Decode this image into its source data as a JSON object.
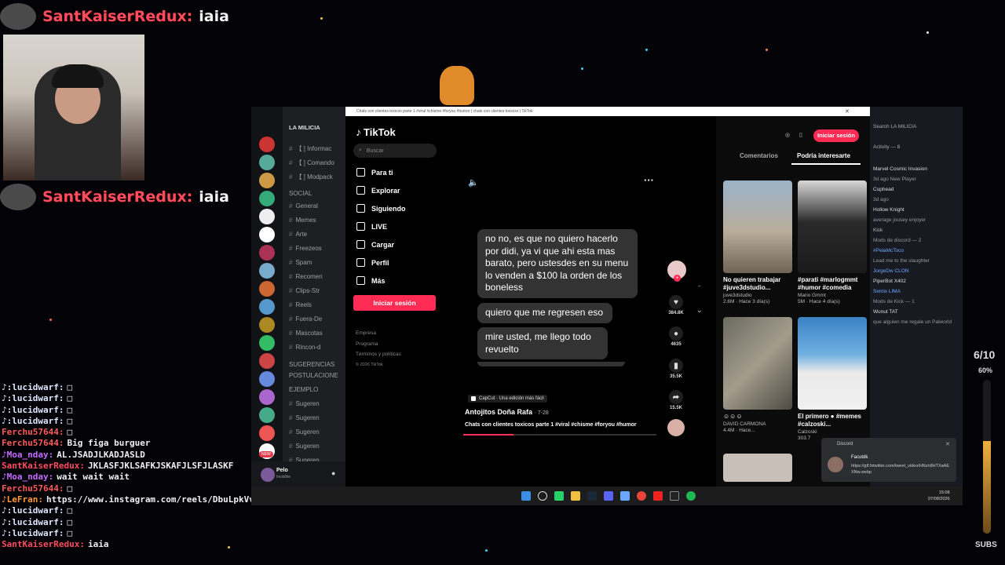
{
  "overlay": {
    "top_user": "SantKaiserRedux:",
    "top_message": "iaia",
    "mid_user": "SantKaiserRedux:",
    "mid_message": "iaia",
    "counter": "6/10",
    "percent": "60%",
    "subs_label": "SUBS"
  },
  "chat": [
    {
      "user": "♪:lucidwarf:",
      "msg": "□",
      "color": "#dfe7ff"
    },
    {
      "user": "♪:lucidwarf:",
      "msg": "□",
      "color": "#dfe7ff"
    },
    {
      "user": "♪:lucidwarf:",
      "msg": "□",
      "color": "#dfe7ff"
    },
    {
      "user": "♪:lucidwarf:",
      "msg": "□",
      "color": "#dfe7ff"
    },
    {
      "user": "Ferchu57644:",
      "msg": "□",
      "color": "#ff5a5a"
    },
    {
      "user": "Ferchu57644:",
      "msg": "Big figa burguer",
      "color": "#ff5a5a"
    },
    {
      "user": "♪Moa_nday:",
      "msg": "AL.JSADJLKADJASLD",
      "color": "#c56bff"
    },
    {
      "user": "SantKaiserRedux:",
      "msg": "JKLASFJKLSAFKJSKAFJLSFJLASKF",
      "color": "#ff4c5e"
    },
    {
      "user": "♪Moa_nday:",
      "msg": "wait wait wait",
      "color": "#c56bff"
    },
    {
      "user": "Ferchu57644:",
      "msg": "□",
      "color": "#ff5a5a"
    },
    {
      "user": "♪LeFran:",
      "msg": "https://www.instagram.com/reels/DbuLpkVvauS/",
      "color": "#ff9a3c"
    },
    {
      "user": "♪:lucidwarf:",
      "msg": "□",
      "color": "#dfe7ff"
    },
    {
      "user": "♪:lucidwarf:",
      "msg": "□",
      "color": "#dfe7ff"
    },
    {
      "user": "♪:lucidwarf:",
      "msg": "□",
      "color": "#dfe7ff"
    },
    {
      "user": "SantKaiserRedux:",
      "msg": "iaia",
      "color": "#ff4c5e"
    }
  ],
  "discord": {
    "server_name": "LA MILICIA",
    "channels": [
      "【 ] Informac",
      "【 ] Comando",
      "【 ] Modpack",
      "SOCIAL",
      "General",
      "Memes",
      "Arte",
      "Freezeos",
      "Spam",
      "Recomen",
      "Clips-Str",
      "Reels",
      "Fuera-De",
      "Mascotas",
      "Rincon-d",
      "SUGERENCIAS",
      "POSTULACIONE",
      "EJEMPLO",
      "Sugeren",
      "Sugeren",
      "Sugeren",
      "Sugeren",
      "Sugeren"
    ],
    "user_name": "Pelo",
    "user_status": "Invisible",
    "new_badge": "NEW"
  },
  "browser": {
    "tab_title": "Chats con clientes toxicos parte 1 #viral #chisme #foryou #humor | chats con clientes toxxxxx | TikTok"
  },
  "tiktok": {
    "logo": "TikTok",
    "search_placeholder": "Buscar",
    "nav": [
      "Para ti",
      "Explorar",
      "Siguiendo",
      "LIVE",
      "Cargar",
      "Perfil",
      "Más"
    ],
    "login_button": "Iniciar sesión",
    "footer": [
      "Empresa",
      "Programa",
      "Términos y políticas",
      "© 2026 TikTok"
    ],
    "header_login": "Iniciar sesión",
    "tabs": [
      "Comentarios",
      "Podría interesarte"
    ],
    "bubbles": [
      "no no, es que no quiero hacerlo por didi, ya vi que ahi esta mas barato, pero ustesdes en su menu lo venden a $100 la orden de los boneless",
      "quiero que me regresen eso",
      "mire usted, me llego todo revuelto"
    ],
    "capcut": "CapCut · Una edición más fácil",
    "author": "Antojitos Doña Rafa",
    "date": "· 7-28",
    "caption": "Chats con clientes toxicos parte 1 #viral #chisme #foryou #humor",
    "likes": "384.8K",
    "comments": "4635",
    "saves": "35.5K",
    "shares": "15.5K",
    "recommended": [
      {
        "title": "No quieren trabajar #juve3dstudio...",
        "author": "juve3dstudio",
        "stats": "2.6M · Hace 3 día(s)"
      },
      {
        "title": "#parati #marlogmmt #humor #comedia",
        "author": "Mario Gmmt",
        "stats": "5M · Hace 4 día(s)"
      },
      {
        "title": "☺☺☺",
        "author": "DAVID CARMONA",
        "stats": "4.4M · Hace..."
      },
      {
        "title": "El primero ● #memes #calzoski...",
        "author": "Calzoski",
        "stats": "303.7"
      }
    ]
  },
  "right_discord": {
    "search": "Search LA MILICIA",
    "activity": "Activity — 8",
    "items": [
      {
        "t": "Marvel Cosmic Invasion",
        "c": "#ddd"
      },
      {
        "t": "3d ago  New Player",
        "c": "#999"
      },
      {
        "t": "Cuphead",
        "c": "#ddd"
      },
      {
        "t": "3d ago",
        "c": "#999"
      },
      {
        "t": "Hollow Knight",
        "c": "#ddd"
      },
      {
        "t": "average jousey enjoyer",
        "c": "#999"
      },
      {
        "t": "Kick",
        "c": "#bbb"
      },
      {
        "t": "Mods de discord — 2",
        "c": "#999"
      },
      {
        "t": "#PelaMcToco",
        "c": "#6fa8ff"
      },
      {
        "t": "Lead me to the slaughter",
        "c": "#999"
      },
      {
        "t": "JorgeDw  CLON",
        "c": "#6fa8ff"
      },
      {
        "t": "PiperBot X402",
        "c": "#ddd"
      },
      {
        "t": "Semix  LIMA",
        "c": "#6fa8ff"
      },
      {
        "t": "Mods de Kick — 1",
        "c": "#999"
      },
      {
        "t": "Wunut  TAT",
        "c": "#ddd"
      },
      {
        "t": "que alguien me regale un Palworld",
        "c": "#999"
      }
    ]
  },
  "toast": {
    "app": "Discord",
    "user": "Facutdk",
    "message": "https://gif.fxtwitter.com/tweet_video/HNzn8HTXaAEXNw.webp"
  },
  "taskbar": {
    "time": "15:08",
    "date": "07/08/2026"
  }
}
